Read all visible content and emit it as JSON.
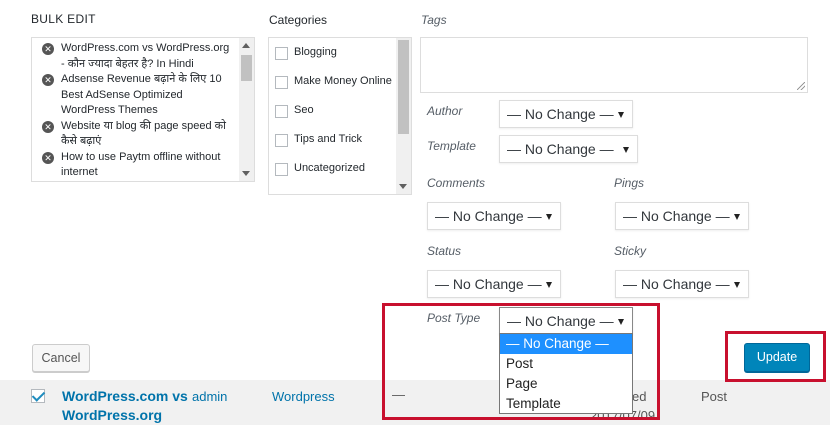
{
  "bulk_edit": {
    "heading": "BULK EDIT",
    "posts": [
      "WordPress.com vs WordPress.org - कौन ज्यादा बेहतर है? In Hindi",
      "Adsense Revenue बढ़ाने के लिए 10 Best AdSense Optimized WordPress Themes",
      "Website या blog की page speed को कैसे बढ़ाएं",
      "How to use Paytm offline without internet"
    ],
    "categories_label": "Categories",
    "categories": [
      "Blogging",
      "Make Money Online",
      "Seo",
      "Tips and Trick",
      "Uncategorized"
    ],
    "tags_label": "Tags",
    "author_label": "Author",
    "author_value": "— No Change —",
    "template_label": "Template",
    "template_value": "— No Change —",
    "comments_label": "Comments",
    "comments_value": "— No Change —",
    "pings_label": "Pings",
    "pings_value": "— No Change —",
    "status_label": "Status",
    "status_value": "— No Change —",
    "sticky_label": "Sticky",
    "sticky_value": "— No Change —",
    "post_type_label": "Post Type",
    "post_type_value": "— No Change —",
    "post_type_options": [
      "— No Change —",
      "Post",
      "Page",
      "Template"
    ],
    "cancel_label": "Cancel",
    "update_label": "Update"
  },
  "row": {
    "title": "WordPress.com vs WordPress.org",
    "author": "admin",
    "category": "Wordpress",
    "tags": "—",
    "date_status": "ed",
    "date": "2017/07/09",
    "type": "Post"
  },
  "colors": {
    "primary_button": "#0085ba",
    "highlight": "#c8102e",
    "link": "#0073aa"
  }
}
